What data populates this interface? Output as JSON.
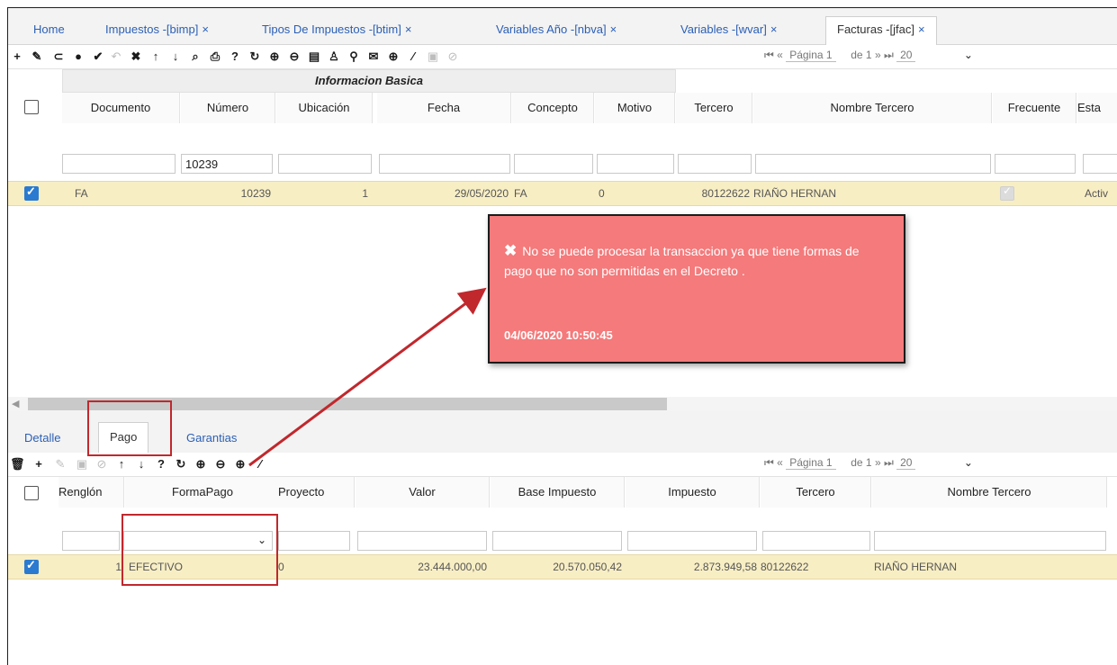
{
  "tabs": [
    {
      "label": "Home",
      "closable": false
    },
    {
      "label": "Impuestos -[bimp]",
      "closable": true
    },
    {
      "label": "Tipos De Impuestos -[btim]",
      "closable": true
    },
    {
      "label": "Variables Año -[nbva]",
      "closable": true
    },
    {
      "label": "Variables -[wvar]",
      "closable": true
    },
    {
      "label": "Facturas -[jfac]",
      "closable": true,
      "active": true
    }
  ],
  "close_glyph": "×",
  "top_pager": {
    "page_label": "Página 1",
    "of_label": "de 1",
    "page_size": "20"
  },
  "main_grid": {
    "group_header": "Informacion Basica",
    "columns": [
      "Documento",
      "Número",
      "Ubicación",
      "Fecha",
      "Concepto",
      "Motivo",
      "Tercero",
      "Nombre Tercero",
      "Frecuente",
      "Esta"
    ],
    "filter_numero": "10239",
    "row": {
      "documento": "FA",
      "numero": "10239",
      "ubicacion": "1",
      "fecha": "29/05/2020",
      "concepto": "FA",
      "motivo": "0",
      "tercero": "80122622",
      "nombre_tercero": "RIAÑO HERNAN",
      "estado": "Activ"
    }
  },
  "error": {
    "message": "No se puede procesar la transaccion ya que tiene formas de pago que no son permitidas en el Decreto .",
    "timestamp": "04/06/2020 10:50:45",
    "color": "#f47a7b"
  },
  "subtabs": [
    "Detalle",
    "Pago",
    "Garantias"
  ],
  "bottom_pager": {
    "page_label": "Página 1",
    "of_label": "de 1",
    "page_size": "20"
  },
  "pago_grid": {
    "columns": [
      "Renglón",
      "FormaPago",
      "Proyecto",
      "Valor",
      "Base Impuesto",
      "Impuesto",
      "Tercero",
      "Nombre Tercero"
    ],
    "row": {
      "renglon": "1",
      "forma_pago": "EFECTIVO",
      "proyecto": "0",
      "valor": "23.444.000,00",
      "base_impuesto": "20.570.050,42",
      "impuesto": "2.873.949,58",
      "tercero": "80122622",
      "nombre_tercero": "RIAÑO HERNAN"
    }
  },
  "annotation_color": "#c0282d"
}
